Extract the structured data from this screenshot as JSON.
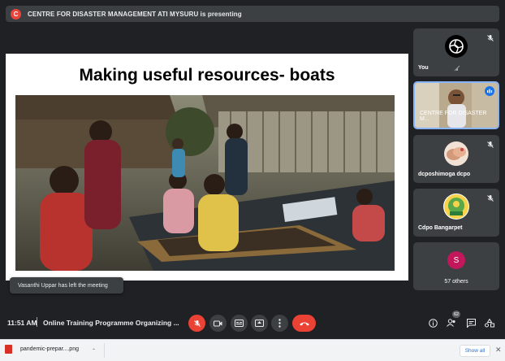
{
  "banner": {
    "badge": "C",
    "text": "CENTRE FOR DISASTER MANAGEMENT ATI MYSURU is presenting"
  },
  "slide": {
    "title": "Making useful resources- boats"
  },
  "toast": {
    "text": "Vasanthi Uppar has left the meeting"
  },
  "participants": [
    {
      "name": "You",
      "avatar": "glyph-avatar-icon",
      "muted": true
    },
    {
      "name": "CENTRE FOR DISASTER M...",
      "avatar": "camera-video",
      "speaking": true
    },
    {
      "name": "dcposhimoga dcpo",
      "avatar": "photo-hands",
      "muted": true
    },
    {
      "name": "Cdpo Bangarpet",
      "avatar": "emblem-logo",
      "muted": true
    },
    {
      "name": "57 others",
      "avatar_letter": "S",
      "avatar_color": "#c2185b"
    }
  ],
  "bottom_bar": {
    "time": "11:51 AM",
    "meeting_title": "Online Training Programme Organizing ...",
    "participants_count": "62"
  },
  "downloads": {
    "file_name": "pandemic-prepar....png",
    "show_all": "Show all"
  },
  "colors": {
    "background": "#202124",
    "tile": "#3c4043",
    "end_call": "#ea4335",
    "active_border": "#8ab4f8"
  }
}
